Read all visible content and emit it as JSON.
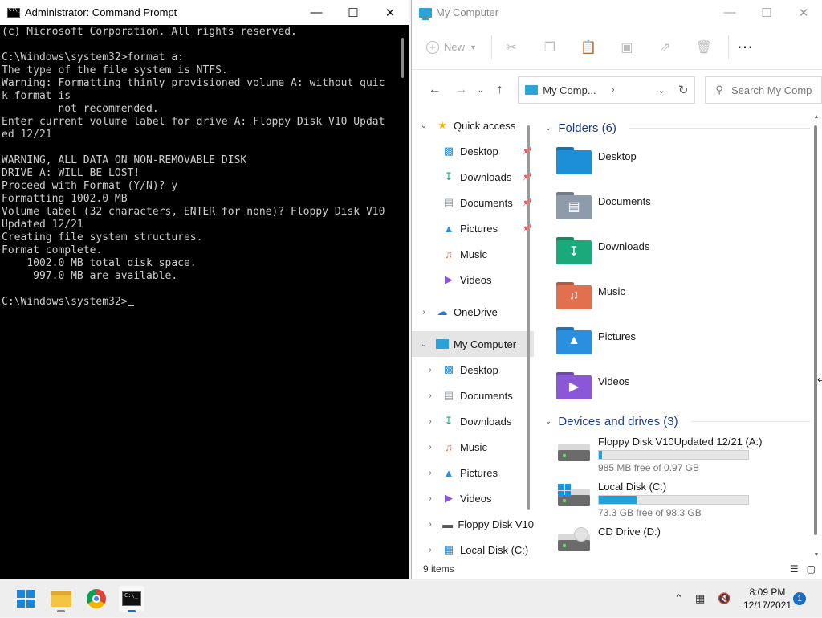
{
  "cmd": {
    "title": "Administrator: Command Prompt",
    "lines": [
      "(c) Microsoft Corporation. All rights reserved.",
      "",
      "C:\\Windows\\system32>format a:",
      "The type of the file system is NTFS.",
      "Warning: Formatting thinly provisioned volume A: without quic",
      "k format is",
      "         not recommended.",
      "Enter current volume label for drive A: Floppy Disk V10 Updat",
      "ed 12/21",
      "",
      "WARNING, ALL DATA ON NON-REMOVABLE DISK",
      "DRIVE A: WILL BE LOST!",
      "Proceed with Format (Y/N)? y",
      "Formatting 1002.0 MB",
      "Volume label (32 characters, ENTER for none)? Floppy Disk V10",
      "Updated 12/21",
      "Creating file system structures.",
      "Format complete.",
      "    1002.0 MB total disk space.",
      "     997.0 MB are available.",
      ""
    ],
    "prompt": "C:\\Windows\\system32>"
  },
  "explorer": {
    "title": "My Computer",
    "toolbar": {
      "new_label": "New"
    },
    "address": {
      "path": "My Comp...",
      "search_placeholder": "Search My Comp"
    },
    "nav": {
      "quick_access": "Quick access",
      "quick_items": [
        {
          "label": "Desktop"
        },
        {
          "label": "Downloads"
        },
        {
          "label": "Documents"
        },
        {
          "label": "Pictures"
        },
        {
          "label": "Music"
        },
        {
          "label": "Videos"
        }
      ],
      "onedrive": "OneDrive",
      "my_computer": "My Computer",
      "pc_items": [
        {
          "label": "Desktop"
        },
        {
          "label": "Documents"
        },
        {
          "label": "Downloads"
        },
        {
          "label": "Music"
        },
        {
          "label": "Pictures"
        },
        {
          "label": "Videos"
        },
        {
          "label": "Floppy Disk V10"
        },
        {
          "label": "Local Disk (C:)"
        }
      ]
    },
    "folders_header": "Folders (6)",
    "folders": [
      {
        "name": "Desktop",
        "color": "#1c8fd8"
      },
      {
        "name": "Documents",
        "color": "#8d9bab"
      },
      {
        "name": "Downloads",
        "color": "#1aa97a"
      },
      {
        "name": "Music",
        "color": "#e2704f"
      },
      {
        "name": "Pictures",
        "color": "#2a8fe0"
      },
      {
        "name": "Videos",
        "color": "#8a57d8"
      }
    ],
    "devices_header": "Devices and drives (3)",
    "drives": [
      {
        "name": "Floppy Disk V10Updated 12/21 (A:)",
        "free": "985 MB free of 0.97 GB",
        "used_fraction": 0.02
      },
      {
        "name": "Local Disk (C:)",
        "free": "73.3 GB free of 98.3 GB",
        "used_fraction": 0.25
      },
      {
        "name": "CD Drive (D:)"
      }
    ],
    "status": "9 items"
  },
  "taskbar": {
    "time": "8:09 PM",
    "date": "12/17/2021",
    "notifications": "1"
  }
}
